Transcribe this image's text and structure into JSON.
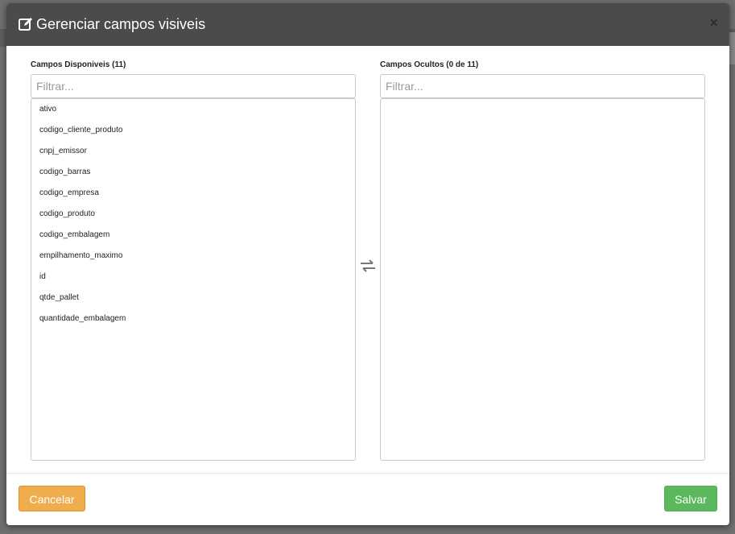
{
  "modal": {
    "title": "Gerenciar campos visiveis",
    "close_symbol": "×"
  },
  "available": {
    "label": "Campos Disponiveis (11)",
    "filter_placeholder": "Filtrar...",
    "items": [
      "ativo",
      "codigo_cliente_produto",
      "cnpj_emissor",
      "codigo_barras",
      "codigo_empresa",
      "codigo_produto",
      "codigo_embalagem",
      "empilhamento_maximo",
      "id",
      "qtde_pallet",
      "quantidade_embalagem"
    ]
  },
  "hidden": {
    "label": "Campos Ocultos (0 de 11)",
    "filter_placeholder": "Filtrar...",
    "items": []
  },
  "footer": {
    "cancel_label": "Cancelar",
    "save_label": "Salvar"
  },
  "icons": {
    "header": "edit-icon",
    "transfer": "swap-arrows-icon"
  },
  "colors": {
    "header_bg": "#4b4b4b",
    "cancel": "#f0ad4e",
    "save": "#5cb85c"
  }
}
